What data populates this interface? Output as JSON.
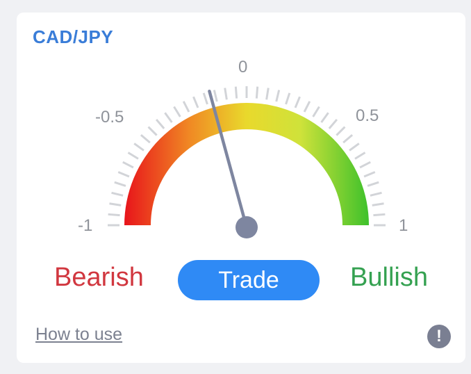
{
  "widget": {
    "pair": "CAD/JPY",
    "scale": {
      "min_label": "-1",
      "low_label": "-0.5",
      "mid_label": "0",
      "high_label": "0.5",
      "max_label": "1",
      "min": -1,
      "max": 1
    },
    "gauge_value": -0.17,
    "bearish_label": "Bearish",
    "bullish_label": "Bullish",
    "trade_button": "Trade",
    "how_to_use": "How to use",
    "info_icon": "exclamation-icon"
  },
  "colors": {
    "title": "#3a7dd8",
    "bearish": "#d1373f",
    "bullish": "#35a151",
    "button": "#2f8af5",
    "needle": "#7e86a0",
    "ticks": "#d2d4d8",
    "gradient": [
      "#e8141b",
      "#f08a24",
      "#e9d92c",
      "#cfe23a",
      "#3ec12b"
    ]
  }
}
